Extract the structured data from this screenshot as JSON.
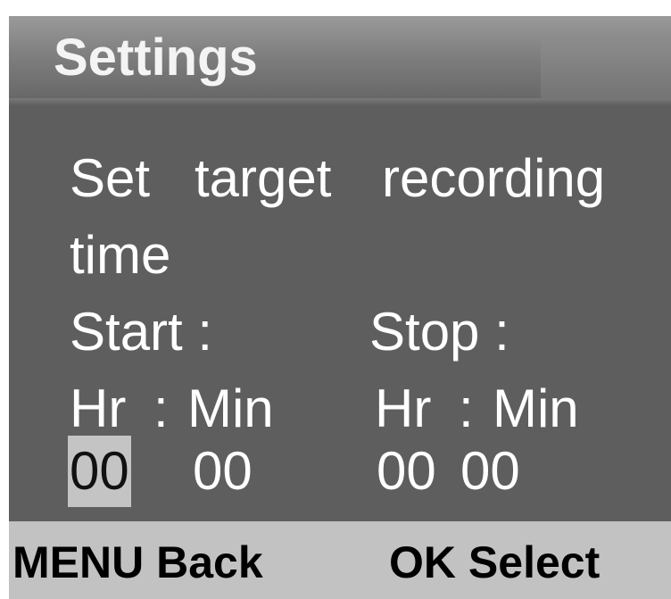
{
  "header": {
    "title": "Settings"
  },
  "main": {
    "prompt_words": [
      "Set",
      "target",
      "recording"
    ],
    "prompt_line2": "time",
    "start_label": "Start :",
    "stop_label": "Stop :",
    "start_units": {
      "hr": "Hr",
      "sep": ":",
      "min": "Min"
    },
    "stop_units": {
      "hr": "Hr",
      "sep": ":",
      "min": "Min"
    },
    "start_values": {
      "hr": "00",
      "min": "00"
    },
    "stop_values": {
      "hr": "00",
      "min": "00"
    },
    "selected_field": "start_hr"
  },
  "footer": {
    "menu_key": "MENU",
    "menu_action": "Back",
    "ok_key": "OK",
    "ok_action": "Select"
  },
  "colors": {
    "screen_bg": "#5e5e5e",
    "text": "#ffffff",
    "footer_bg": "#c2c2c2",
    "selection_bg": "#c4c4c4"
  }
}
